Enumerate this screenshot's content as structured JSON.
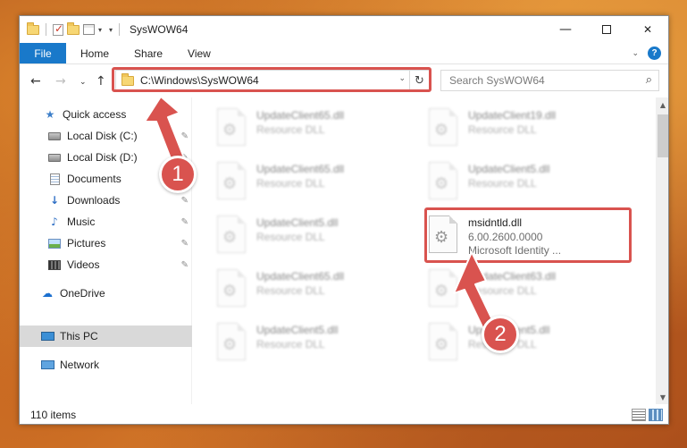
{
  "window": {
    "title": "SysWOW64"
  },
  "ribbon": {
    "tabs": [
      "File",
      "Home",
      "Share",
      "View"
    ]
  },
  "navbar": {
    "address": "C:\\Windows\\SysWOW64",
    "search_placeholder": "Search SysWOW64"
  },
  "sidebar": {
    "quick_access": "Quick access",
    "items": [
      {
        "label": "Local Disk (C:)",
        "icon": "disk-icon"
      },
      {
        "label": "Local Disk (D:)",
        "icon": "disk-icon"
      },
      {
        "label": "Documents",
        "icon": "documents-icon"
      },
      {
        "label": "Downloads",
        "icon": "downloads-icon"
      },
      {
        "label": "Music",
        "icon": "music-icon"
      },
      {
        "label": "Pictures",
        "icon": "pictures-icon"
      },
      {
        "label": "Videos",
        "icon": "videos-icon"
      }
    ],
    "onedrive": "OneDrive",
    "this_pc": "This PC",
    "network": "Network"
  },
  "files": [
    {
      "name": "UpdateClient65.dll",
      "type": "Resource DLL"
    },
    {
      "name": "UpdateClient19.dll",
      "type": "Resource DLL"
    },
    {
      "name": "UpdateClient65.dll",
      "type": "Resource DLL"
    },
    {
      "name": "UpdateClient5.dll",
      "type": "Resource DLL"
    },
    {
      "name": "UpdateClient5.dll",
      "type": "Resource DLL"
    },
    {
      "name": "msidntld.dll",
      "version": "6.00.2600.0000",
      "description": "Microsoft Identity ..."
    },
    {
      "name": "UpdateClient65.dll",
      "type": "Resource DLL"
    },
    {
      "name": "UpdateClient63.dll",
      "type": "Resource DLL"
    },
    {
      "name": "UpdateClient5.dll",
      "type": "Resource DLL"
    },
    {
      "name": "UpdateClient5.dll",
      "type": "Resource DLL"
    }
  ],
  "status": {
    "item_count": "110 items"
  },
  "annotations": {
    "step1": "1",
    "step2": "2",
    "color": "#d9534f"
  },
  "colors": {
    "accent": "#1979ca"
  }
}
